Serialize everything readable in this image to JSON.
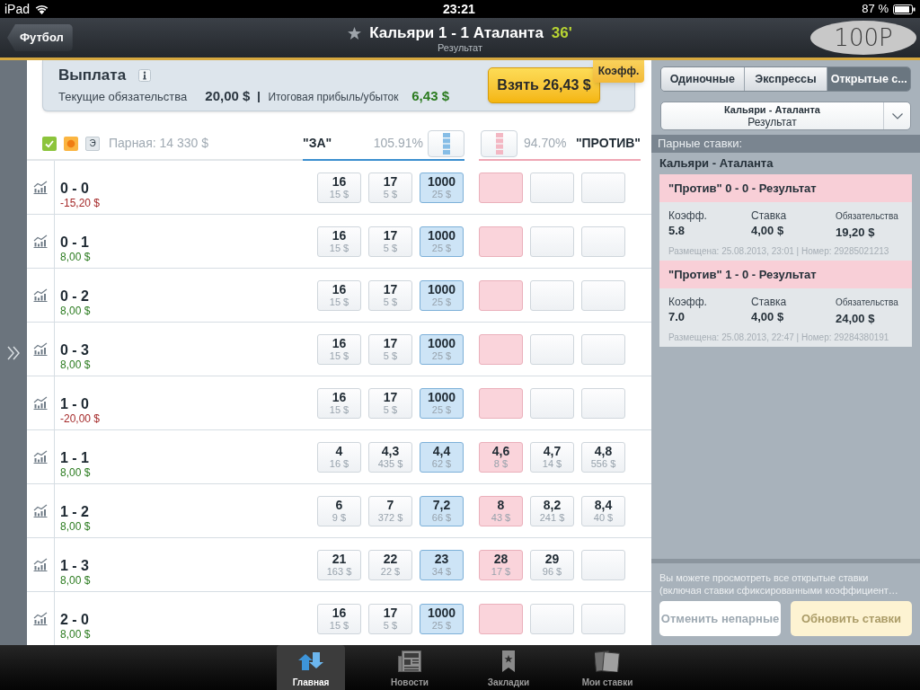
{
  "status_bar": {
    "device": "iPad",
    "time": "23:21",
    "battery": "87 %"
  },
  "nav_bar": {
    "back_button": "Футбол",
    "starred": false,
    "title": "Кальяри 1 - 1 Аталанта",
    "minute": "36'",
    "subtitle": "Результат",
    "scribble": "100P"
  },
  "payout": {
    "title": "Выплата",
    "liability_label": "Текущие обязательства",
    "liability": "20,00 $",
    "profit_label": "Итоговая прибыль/убыток",
    "profit": "6,43 $",
    "take_button": "Взять 26,43 $",
    "odds_tab": "Коэфф."
  },
  "market": {
    "filters": [
      {
        "kind": "check",
        "on": true
      },
      {
        "kind": "dot",
        "on": true
      },
      {
        "kind": "letter",
        "label": "Э",
        "on": false
      }
    ],
    "matched": "Парная: 14 330 $",
    "back_label": "\"ЗА\"",
    "back_percent": "105.91%",
    "lay_percent": "94.70%",
    "lay_label": "\"ПРОТИВ\"",
    "rows": [
      {
        "score": "0 - 0",
        "pnl": "-15,20 $",
        "loss": true,
        "back": [
          {
            "odds": "16",
            "amount": "15 $"
          },
          {
            "odds": "17",
            "amount": "5 $"
          },
          {
            "odds": "1000",
            "amount": "25 $"
          }
        ]
      },
      {
        "score": "0 - 1",
        "pnl": "8,00 $",
        "loss": false,
        "back": [
          {
            "odds": "16",
            "amount": "15 $"
          },
          {
            "odds": "17",
            "amount": "5 $"
          },
          {
            "odds": "1000",
            "amount": "25 $"
          }
        ]
      },
      {
        "score": "0 - 2",
        "pnl": "8,00 $",
        "loss": false,
        "back": [
          {
            "odds": "16",
            "amount": "15 $"
          },
          {
            "odds": "17",
            "amount": "5 $"
          },
          {
            "odds": "1000",
            "amount": "25 $"
          }
        ]
      },
      {
        "score": "0 - 3",
        "pnl": "8,00 $",
        "loss": false,
        "back": [
          {
            "odds": "16",
            "amount": "15 $"
          },
          {
            "odds": "17",
            "amount": "5 $"
          },
          {
            "odds": "1000",
            "amount": "25 $"
          }
        ]
      },
      {
        "score": "1 - 0",
        "pnl": "-20,00 $",
        "loss": true,
        "back": [
          {
            "odds": "16",
            "amount": "15 $"
          },
          {
            "odds": "17",
            "amount": "5 $"
          },
          {
            "odds": "1000",
            "amount": "25 $"
          }
        ]
      },
      {
        "score": "1 - 1",
        "pnl": "8,00 $",
        "loss": false,
        "back": [
          {
            "odds": "4",
            "amount": "16 $"
          },
          {
            "odds": "4,3",
            "amount": "435 $"
          },
          {
            "odds": "4,4",
            "amount": "62 $"
          }
        ],
        "lay": [
          {
            "odds": "4,6",
            "amount": "8 $"
          },
          {
            "odds": "4,7",
            "amount": "14 $"
          },
          {
            "odds": "4,8",
            "amount": "556 $"
          }
        ]
      },
      {
        "score": "1 - 2",
        "pnl": "8,00 $",
        "loss": false,
        "back": [
          {
            "odds": "6",
            "amount": "9 $"
          },
          {
            "odds": "7",
            "amount": "372 $"
          },
          {
            "odds": "7,2",
            "amount": "66 $"
          }
        ],
        "lay": [
          {
            "odds": "8",
            "amount": "43 $"
          },
          {
            "odds": "8,2",
            "amount": "241 $"
          },
          {
            "odds": "8,4",
            "amount": "40 $"
          }
        ]
      },
      {
        "score": "1 - 3",
        "pnl": "8,00 $",
        "loss": false,
        "back": [
          {
            "odds": "21",
            "amount": "163 $"
          },
          {
            "odds": "22",
            "amount": "22 $"
          },
          {
            "odds": "23",
            "amount": "34 $"
          }
        ],
        "lay": [
          {
            "odds": "28",
            "amount": "17 $"
          },
          {
            "odds": "29",
            "amount": "96 $"
          }
        ]
      },
      {
        "score": "2 - 0",
        "pnl": "8,00 $",
        "loss": false,
        "back": [
          {
            "odds": "16",
            "amount": "15 $"
          },
          {
            "odds": "17",
            "amount": "5 $"
          },
          {
            "odds": "1000",
            "amount": "25 $"
          }
        ]
      }
    ]
  },
  "bet_slip": {
    "tabs": [
      {
        "label": "Одиночные",
        "selected": false
      },
      {
        "label": "Экспрессы",
        "selected": false
      },
      {
        "label": "Открытые с...",
        "selected": true
      }
    ],
    "market_picker": {
      "event": "Кальяри - Аталанта",
      "market": "Результат"
    },
    "section": "Парные ставки:",
    "event": "Кальяри - Аталанта",
    "bets": [
      {
        "title": "\"Против\" 0 - 0 - Результат",
        "lay": true,
        "fields": [
          {
            "label": "Коэфф.",
            "value": "5.8"
          },
          {
            "label": "Ставка",
            "value": "4,00 $"
          },
          {
            "label": "Обязательства",
            "value": "19,20 $"
          }
        ],
        "meta": "Размещена: 25.08.2013, 23:01 | Номер: 29285021213"
      },
      {
        "title": "\"Против\" 1 - 0 - Результат",
        "lay": true,
        "fields": [
          {
            "label": "Коэфф.",
            "value": "7.0"
          },
          {
            "label": "Ставка",
            "value": "4,00 $"
          },
          {
            "label": "Обязательства",
            "value": "24,00 $"
          }
        ],
        "meta": "Размещена: 25.08.2013, 22:47 | Номер: 29284380191"
      }
    ],
    "note": "Вы можете просмотреть все открытые ставки (включая ставки сфиксированными коэффициент…",
    "buttons": [
      {
        "label": "Отменить непарные",
        "kind": "cancel",
        "disabled": true
      },
      {
        "label": "Обновить ставки",
        "kind": "update",
        "disabled": true
      }
    ]
  },
  "tab_bar": [
    {
      "label": "Главная",
      "kind": "home",
      "selected": true
    },
    {
      "label": "Новости",
      "kind": "news",
      "selected": false
    },
    {
      "label": "Закладки",
      "kind": "bookmarks",
      "selected": false
    },
    {
      "label": "Мои ставки",
      "kind": "my_bets",
      "selected": false
    }
  ]
}
